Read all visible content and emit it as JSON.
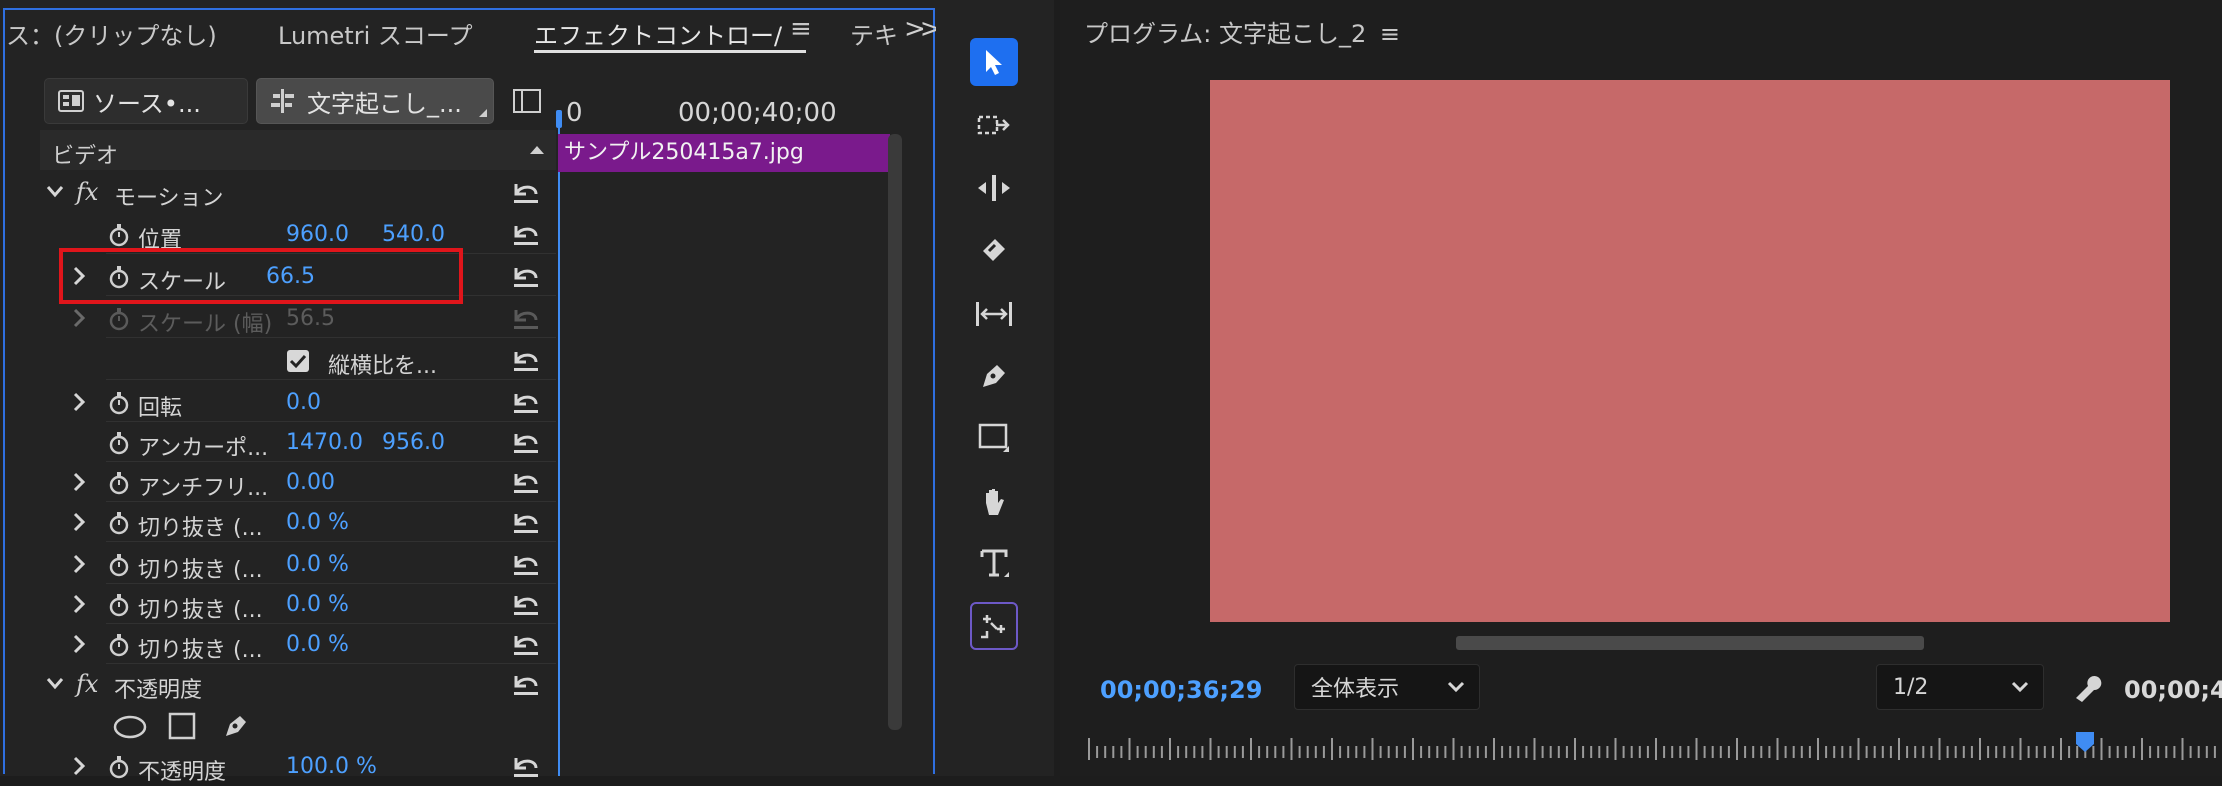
{
  "effect_controls": {
    "tabs": [
      {
        "label": "ス：(クリップなし)"
      },
      {
        "label": "Lumetri スコープ"
      },
      {
        "label": "エフェクトコントロー/"
      },
      {
        "label": "テキ"
      }
    ],
    "tab_menu": "≡",
    "tab_overflow": ">>",
    "source_pill": "ソース•...",
    "sequence_pill": "文字起こし_...",
    "section_video": "ビデオ",
    "motion": {
      "label": "モーション",
      "properties": {
        "position": {
          "label": "位置",
          "x": "960.0",
          "y": "540.0"
        },
        "scale": {
          "label": "スケール",
          "value": "66.5"
        },
        "scale_width": {
          "label": "スケール (幅)",
          "value": "56.5"
        },
        "uniform_scale": {
          "label": "縦横比を...",
          "checked": true
        },
        "rotation": {
          "label": "回転",
          "value": "0.0"
        },
        "anchor": {
          "label": "アンカーポ...",
          "x": "1470.0",
          "y": "956.0"
        },
        "antiflicker": {
          "label": "アンチフリ...",
          "value": "0.00"
        },
        "crop1": {
          "label": "切り抜き (...",
          "value": "0.0 %"
        },
        "crop2": {
          "label": "切り抜き (...",
          "value": "0.0 %"
        },
        "crop3": {
          "label": "切り抜き (...",
          "value": "0.0 %"
        },
        "crop4": {
          "label": "切り抜き (...",
          "value": "0.0 %"
        }
      }
    },
    "opacity": {
      "label": "不透明度",
      "value_label": "不透明度",
      "value": "100.0 %"
    },
    "timeline": {
      "zero": "0",
      "timecode": "00;00;40;00",
      "clip_name": "サンプル250415a7.jpg"
    }
  },
  "tools": [
    "selection-tool",
    "track-select-tool",
    "ripple-edit-tool",
    "razor-tool",
    "slip-tool",
    "pen-tool",
    "rectangle-tool",
    "hand-tool",
    "type-tool",
    "auto-reframe-tool"
  ],
  "program_monitor": {
    "title": "プログラム: 文字起こし_2",
    "title_menu": "≡",
    "canvas_color": "#c66969",
    "timecode": "00;00;36;29",
    "zoom_fit": "全体表示",
    "resolution": "1/2",
    "duration": "00;00;4"
  },
  "colors": {
    "accent_blue": "#4da0ff",
    "clip_purple": "#7a1a8c",
    "highlight_red": "#e0151b"
  }
}
